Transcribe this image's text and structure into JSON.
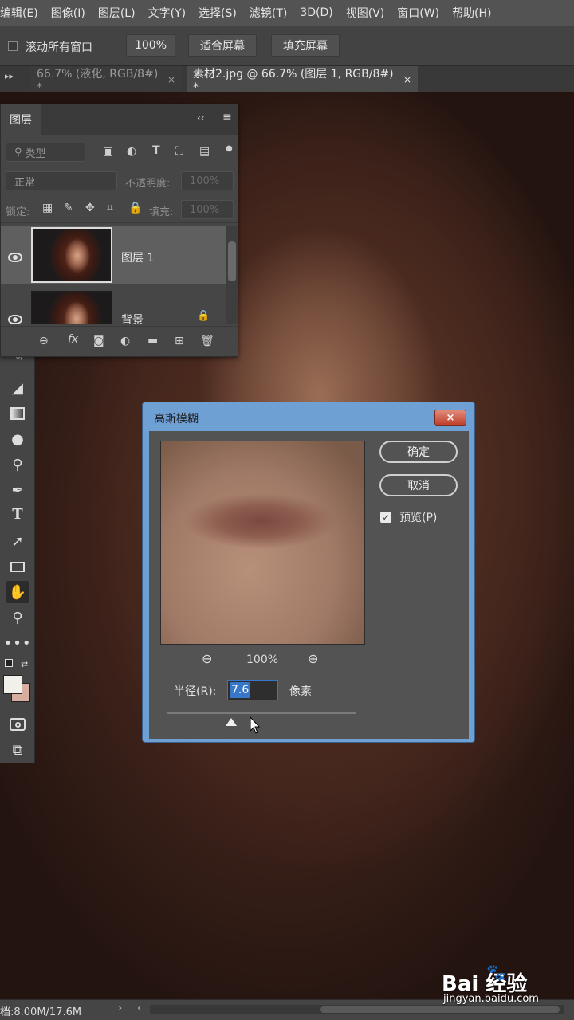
{
  "menubar": {
    "items": [
      "编辑(E)",
      "图像(I)",
      "图层(L)",
      "文字(Y)",
      "选择(S)",
      "滤镜(T)",
      "3D(D)",
      "视图(V)",
      "窗口(W)",
      "帮助(H)"
    ]
  },
  "options": {
    "scroll_all_label": "滚动所有窗口",
    "zoom_value": "100%",
    "fit_screen": "适合屏幕",
    "fill_screen": "填充屏幕"
  },
  "tabs": [
    {
      "label": "66.7% (液化, RGB/8#) *",
      "close": "×"
    },
    {
      "label": "素材2.jpg @ 66.7% (图层 1, RGB/8#) *",
      "close": "×"
    }
  ],
  "layers_panel": {
    "title": "图层",
    "filter_placeholder": "类型",
    "blend_mode": "正常",
    "opacity_label": "不透明度:",
    "opacity_value": "100%",
    "lock_label": "锁定:",
    "fill_label": "填充:",
    "fill_value": "100%",
    "layers": [
      {
        "name": "图层 1"
      },
      {
        "name": "背景"
      }
    ]
  },
  "dialog": {
    "title": "高斯模糊",
    "close": "×",
    "ok": "确定",
    "cancel": "取消",
    "preview_label": "预览(P)",
    "preview_checked": true,
    "preview_zoom": "100%",
    "radius_label": "半径(R):",
    "radius_value": "7.6",
    "radius_unit": "像素",
    "radius_slider_fraction": 0.34
  },
  "statusbar": {
    "doc_info": "档:8.00M/17.6M"
  },
  "watermark": {
    "brand": "Bai  经验",
    "url": "jingyan.baidu.com"
  },
  "colors": {
    "menu_bg": "#535353",
    "dialog_frame": "#6fa0d4",
    "selection": "#3876c8"
  }
}
